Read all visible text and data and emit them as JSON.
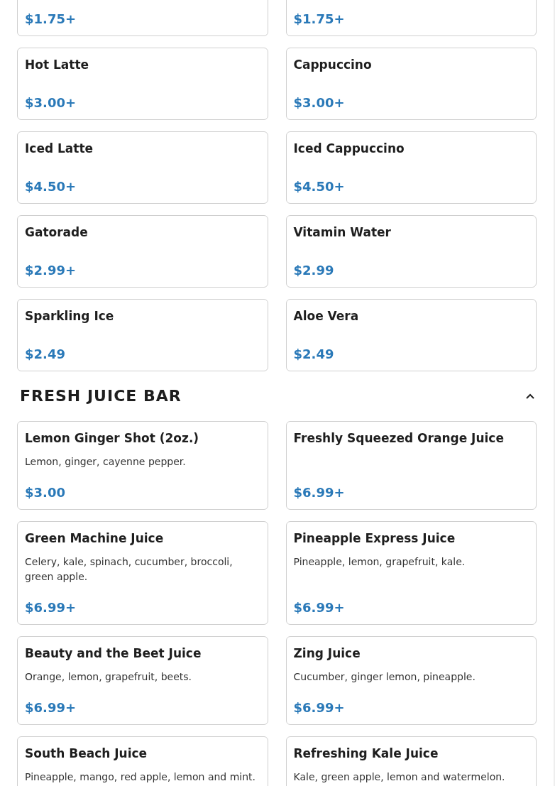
{
  "sections": [
    {
      "items": [
        {
          "price": "$1.75+"
        },
        {
          "price": "$1.75+"
        },
        {
          "name": "Hot Latte",
          "price": "$3.00+"
        },
        {
          "name": "Cappuccino",
          "price": "$3.00+"
        },
        {
          "name": "Iced Latte",
          "price": "$4.50+"
        },
        {
          "name": "Iced Cappuccino",
          "price": "$4.50+"
        },
        {
          "name": "Gatorade",
          "price": "$2.99+"
        },
        {
          "name": "Vitamin Water",
          "price": "$2.99"
        },
        {
          "name": "Sparkling Ice",
          "price": "$2.49"
        },
        {
          "name": "Aloe Vera",
          "price": "$2.49"
        }
      ]
    },
    {
      "title": "FRESH JUICE BAR",
      "expanded": true,
      "items": [
        {
          "name": "Lemon Ginger Shot (2oz.)",
          "description": "Lemon, ginger, cayenne pepper.",
          "price": "$3.00"
        },
        {
          "name": "Freshly Squeezed Orange Juice",
          "price": "$6.99+"
        },
        {
          "name": "Green Machine Juice",
          "description": "Celery, kale, spinach, cucumber, broccoli, green apple.",
          "price": "$6.99+"
        },
        {
          "name": "Pineapple Express Juice",
          "description": "Pineapple, lemon, grapefruit, kale.",
          "price": "$6.99+"
        },
        {
          "name": "Beauty and the Beet Juice",
          "description": "Orange, lemon, grapefruit, beets.",
          "price": "$6.99+"
        },
        {
          "name": "Zing Juice",
          "description": "Cucumber, ginger lemon, pineapple.",
          "price": "$6.99+"
        },
        {
          "name": "South Beach Juice",
          "description": "Pineapple, mango, red apple, lemon and mint."
        },
        {
          "name": "Refreshing Kale Juice",
          "description": "Kale, green apple, lemon and watermelon."
        }
      ]
    }
  ]
}
